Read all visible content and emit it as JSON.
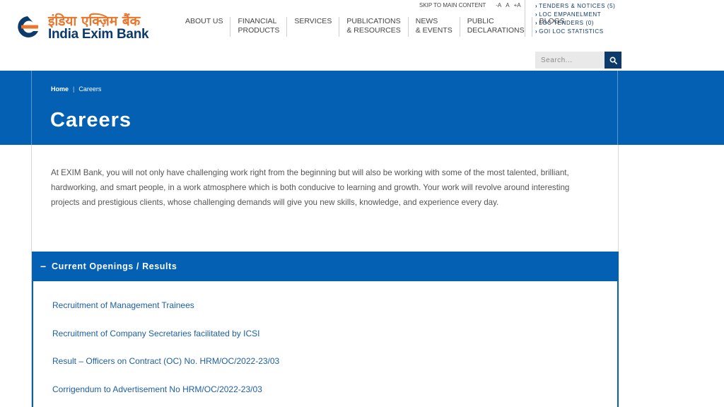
{
  "logo": {
    "hindi": "इंडिया एक्ज़िम बैंक",
    "english": "India Exim Bank"
  },
  "utility": {
    "skip": "SKIP TO MAIN CONTENT",
    "font_decrease": "-A",
    "font_normal": "A",
    "font_increase": "+A"
  },
  "nav": [
    {
      "line1": "ABOUT US",
      "line2": ""
    },
    {
      "line1": "FINANCIAL",
      "line2": "PRODUCTS"
    },
    {
      "line1": "SERVICES",
      "line2": ""
    },
    {
      "line1": "PUBLICATIONS",
      "line2": "& RESOURCES"
    },
    {
      "line1": "NEWS",
      "line2": "& EVENTS"
    },
    {
      "line1": "PUBLIC",
      "line2": "DECLARATIONS"
    },
    {
      "line1": "BLOGS",
      "line2": ""
    }
  ],
  "quick_links": [
    "TENDERS & NOTICES (5)",
    "LOC EMPANELMENT",
    "LOC TENDERS (0)",
    "GOI LOC STATISTICS"
  ],
  "search": {
    "placeholder": "Search..."
  },
  "breadcrumb": {
    "home": "Home",
    "separator": "|",
    "current": "Careers"
  },
  "page_title": "Careers",
  "intro": "At EXIM Bank, you will not only have challenging work right from the beginning but will also be working with some of the most talented, brilliant, hardworking, and smart people, in a work atmosphere which is both conducive to learning and growth. Your work will revolve around interesting projects and prestigious clients, whose challenging demands will give you new skills, knowledge, and experience every day.",
  "accordion": {
    "toggle": "−",
    "title": "Current Openings / Results",
    "links": [
      "Recruitment of Management Trainees",
      "Recruitment of Company Secretaries facilitated by ICSI",
      "Result – Officers on Contract (OC) No. HRM/OC/2022-23/03",
      "Corrigendum to Advertisement No HRM/OC/2022-23/03"
    ]
  },
  "colors": {
    "brand_blue": "#0360b3",
    "navy": "#0c3a6b",
    "orange": "#e8762b"
  }
}
